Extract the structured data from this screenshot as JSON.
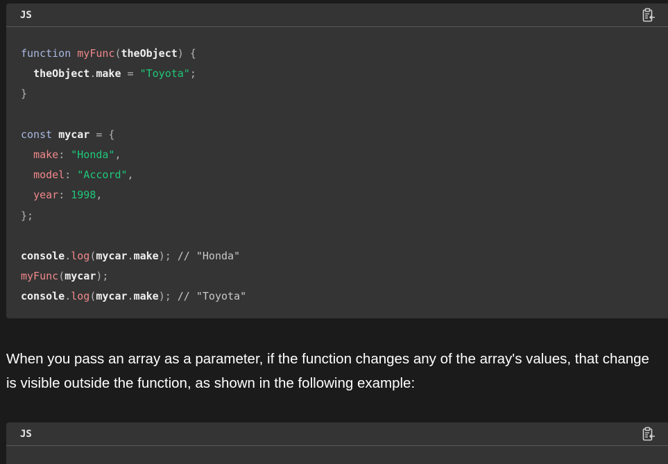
{
  "code_block_1": {
    "language": "JS",
    "copy_icon": "clipboard-copy-icon",
    "lines": [
      [
        {
          "t": "kw",
          "v": "function"
        },
        {
          "t": "punct",
          "v": " "
        },
        {
          "t": "fn",
          "v": "myFunc"
        },
        {
          "t": "punct",
          "v": "("
        },
        {
          "t": "var",
          "v": "theObject"
        },
        {
          "t": "punct",
          "v": ") {"
        }
      ],
      [
        {
          "t": "punct",
          "v": "  "
        },
        {
          "t": "var",
          "v": "theObject"
        },
        {
          "t": "punct",
          "v": "."
        },
        {
          "t": "var",
          "v": "make"
        },
        {
          "t": "punct",
          "v": " = "
        },
        {
          "t": "str",
          "v": "\"Toyota\""
        },
        {
          "t": "punct",
          "v": ";"
        }
      ],
      [
        {
          "t": "punct",
          "v": "}"
        }
      ],
      [],
      [
        {
          "t": "kw",
          "v": "const"
        },
        {
          "t": "punct",
          "v": " "
        },
        {
          "t": "var",
          "v": "mycar"
        },
        {
          "t": "punct",
          "v": " = {"
        }
      ],
      [
        {
          "t": "punct",
          "v": "  "
        },
        {
          "t": "prop",
          "v": "make"
        },
        {
          "t": "punct",
          "v": ": "
        },
        {
          "t": "str",
          "v": "\"Honda\""
        },
        {
          "t": "punct",
          "v": ","
        }
      ],
      [
        {
          "t": "punct",
          "v": "  "
        },
        {
          "t": "prop",
          "v": "model"
        },
        {
          "t": "punct",
          "v": ": "
        },
        {
          "t": "str",
          "v": "\"Accord\""
        },
        {
          "t": "punct",
          "v": ","
        }
      ],
      [
        {
          "t": "punct",
          "v": "  "
        },
        {
          "t": "prop",
          "v": "year"
        },
        {
          "t": "punct",
          "v": ": "
        },
        {
          "t": "num",
          "v": "1998"
        },
        {
          "t": "punct",
          "v": ","
        }
      ],
      [
        {
          "t": "punct",
          "v": "};"
        }
      ],
      [],
      [
        {
          "t": "var",
          "v": "console"
        },
        {
          "t": "punct",
          "v": "."
        },
        {
          "t": "fn",
          "v": "log"
        },
        {
          "t": "punct",
          "v": "("
        },
        {
          "t": "var",
          "v": "mycar"
        },
        {
          "t": "punct",
          "v": "."
        },
        {
          "t": "var",
          "v": "make"
        },
        {
          "t": "punct",
          "v": "); "
        },
        {
          "t": "com",
          "v": "// \"Honda\""
        }
      ],
      [
        {
          "t": "fn",
          "v": "myFunc"
        },
        {
          "t": "punct",
          "v": "("
        },
        {
          "t": "var",
          "v": "mycar"
        },
        {
          "t": "punct",
          "v": ");"
        }
      ],
      [
        {
          "t": "var",
          "v": "console"
        },
        {
          "t": "punct",
          "v": "."
        },
        {
          "t": "fn",
          "v": "log"
        },
        {
          "t": "punct",
          "v": "("
        },
        {
          "t": "var",
          "v": "mycar"
        },
        {
          "t": "punct",
          "v": "."
        },
        {
          "t": "var",
          "v": "make"
        },
        {
          "t": "punct",
          "v": "); "
        },
        {
          "t": "com",
          "v": "// \"Toyota\""
        }
      ]
    ]
  },
  "paragraph": {
    "text": "When you pass an array as a parameter, if the function changes any of the array's values, that change is visible outside the function, as shown in the following example:"
  },
  "code_block_2": {
    "language": "JS",
    "copy_icon": "clipboard-copy-icon"
  },
  "colors": {
    "page_background": "#1b1b1b",
    "code_background": "#343434",
    "keyword": "#a9b8e0",
    "function": "#f1888b",
    "string": "#1ec87a",
    "comment": "#c8c8c8"
  }
}
